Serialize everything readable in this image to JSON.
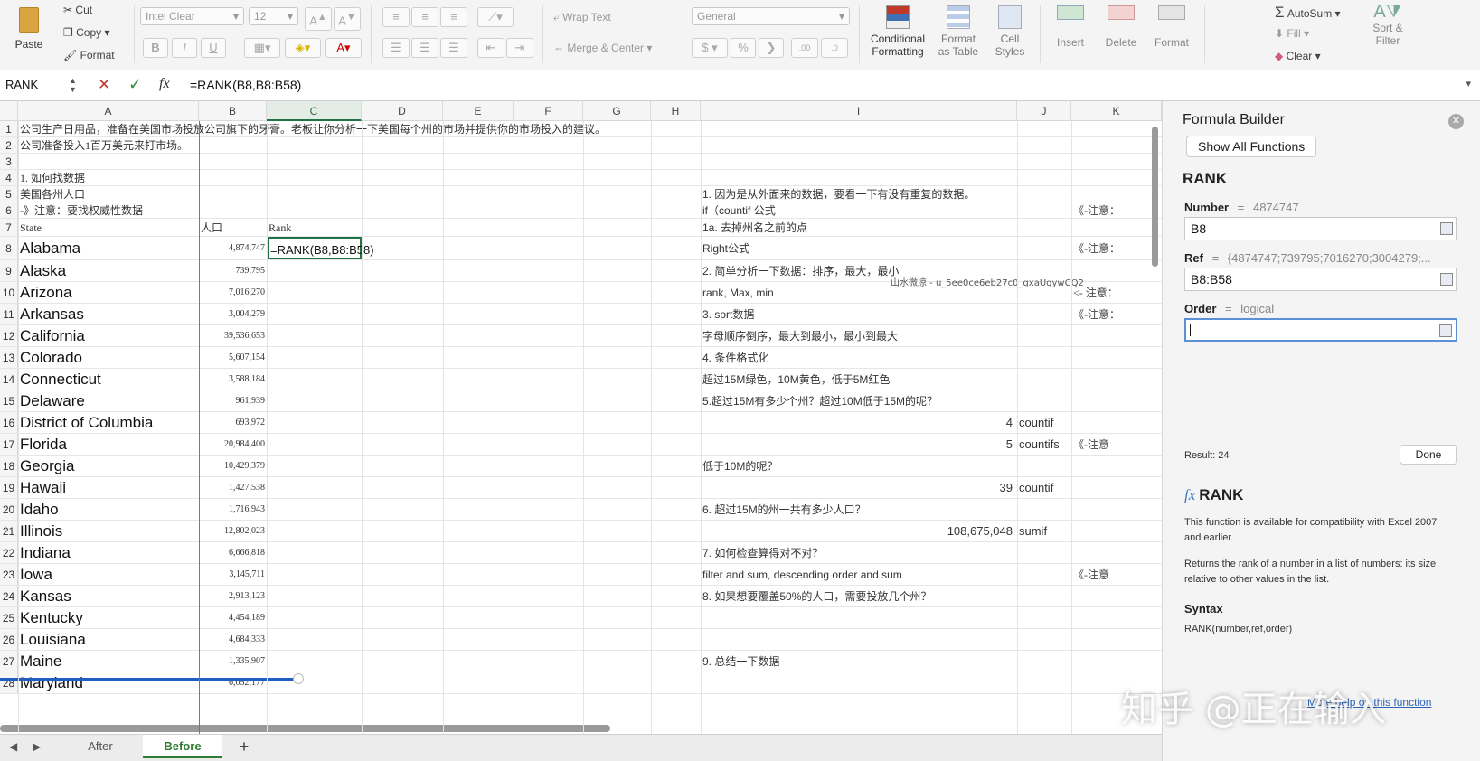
{
  "ribbon": {
    "paste": "Paste",
    "cut": "Cut",
    "copy": "Copy",
    "format_painter": "Format",
    "font_name": "Intel Clear",
    "font_size": "12",
    "bold": "B",
    "italic": "I",
    "underline": "U",
    "wrap_text": "Wrap Text",
    "merge_center": "Merge & Center",
    "number_format": "General",
    "conditional_formatting": [
      "Conditional",
      "Formatting"
    ],
    "format_as_table": [
      "Format",
      "as Table"
    ],
    "cell_styles": [
      "Cell",
      "Styles"
    ],
    "insert": "Insert",
    "delete": "Delete",
    "format": "Format",
    "autosum": "AutoSum",
    "fill": "Fill",
    "clear": "Clear",
    "sort_filter": [
      "Sort &",
      "Filter"
    ]
  },
  "formula_bar": {
    "name_box": "RANK",
    "cancel": "✕",
    "enter": "✓",
    "fx": "fx",
    "formula": "=RANK(B8,B8:B58)"
  },
  "columns": [
    "A",
    "B",
    "C",
    "D",
    "E",
    "F",
    "G",
    "H",
    "I",
    "J",
    "K"
  ],
  "rows": [
    {
      "n": "1",
      "a": "公司生产日用品，准备在美国市场投放公司旗下的牙膏。老板让你分析一下美国每个州的市场并提供你的市场投入的建议。"
    },
    {
      "n": "2",
      "a": "公司准备投入1百万美元来打市场。"
    },
    {
      "n": "3"
    },
    {
      "n": "4",
      "a": "1. 如何找数据"
    },
    {
      "n": "5",
      "a": "美国各州人口",
      "i": "1. 因为是从外面来的数据，要看一下有没有重复的数据。"
    },
    {
      "n": "6",
      "a": "-》注意：要找权威性数据",
      "i": "if（countif 公式",
      "k": "《-注意："
    },
    {
      "n": "7",
      "a": "State",
      "b": "人口",
      "c": "Rank",
      "i": "1a. 去掉州名之前的点"
    },
    {
      "n": "8",
      "a": "Alabama",
      "b": "4,874,747",
      "c": "=RANK(B8,B8:B58)",
      "i": "Right公式",
      "k": "《-注意："
    },
    {
      "n": "9",
      "a": "Alaska",
      "b": "739,795",
      "i": "2. 简单分析一下数据：排序，最大，最小"
    },
    {
      "n": "10",
      "a": "Arizona",
      "b": "7,016,270",
      "i": "rank,  Max,  min",
      "k": "<- 注意："
    },
    {
      "n": "11",
      "a": "Arkansas",
      "b": "3,004,279",
      "i": "3. sort数据",
      "k": "《-注意："
    },
    {
      "n": "12",
      "a": "California",
      "b": "39,536,653",
      "i": "字母顺序倒序，最大到最小，最小到最大"
    },
    {
      "n": "13",
      "a": "Colorado",
      "b": "5,607,154",
      "i": "4. 条件格式化"
    },
    {
      "n": "14",
      "a": "Connecticut",
      "b": "3,588,184",
      "i": "超过15M绿色，10M黄色，低于5M红色"
    },
    {
      "n": "15",
      "a": "Delaware",
      "b": "961,939",
      "i": "5.超过15M有多少个州？超过10M低于15M的呢？"
    },
    {
      "n": "16",
      "a": "District of Columbia",
      "b": "693,972",
      "iv": "4",
      "j": "countif"
    },
    {
      "n": "17",
      "a": "Florida",
      "b": "20,984,400",
      "iv": "5",
      "j": "countifs",
      "k": "《-注意"
    },
    {
      "n": "18",
      "a": "Georgia",
      "b": "10,429,379",
      "i": "低于10M的呢？"
    },
    {
      "n": "19",
      "a": "Hawaii",
      "b": "1,427,538",
      "iv": "39",
      "j": "countif"
    },
    {
      "n": "20",
      "a": "Idaho",
      "b": "1,716,943",
      "i": "6. 超过15M的州一共有多少人口？"
    },
    {
      "n": "21",
      "a": "Illinois",
      "b": "12,802,023",
      "iv": "108,675,048",
      "j": "sumif"
    },
    {
      "n": "22",
      "a": "Indiana",
      "b": "6,666,818",
      "i": "7. 如何检查算得对不对？"
    },
    {
      "n": "23",
      "a": "Iowa",
      "b": "3,145,711",
      "i": "filter and sum, descending order and sum",
      "k": "《-注意"
    },
    {
      "n": "24",
      "a": "Kansas",
      "b": "2,913,123",
      "i": "8. 如果想要覆盖50%的人口，需要投放几个州？"
    },
    {
      "n": "25",
      "a": "Kentucky",
      "b": "4,454,189"
    },
    {
      "n": "26",
      "a": "Louisiana",
      "b": "4,684,333"
    },
    {
      "n": "27",
      "a": "Maine",
      "b": "1,335,907",
      "i": "9. 总结一下数据"
    },
    {
      "n": "28",
      "a": "Maryland",
      "b": "6,052,177"
    }
  ],
  "overlay_text": "山水微凉 - u_5ee0ce6eb27c0_gxaUgywCQ2",
  "sheet_tabs": [
    "After",
    "Before"
  ],
  "add_sheet": "+",
  "panel": {
    "title": "Formula Builder",
    "show_all": "Show All Functions",
    "func": "RANK",
    "number_label": "Number",
    "number_hint": "4874747",
    "number_value": "B8",
    "ref_label": "Ref",
    "ref_hint": "{4874747;739795;7016270;3004279;...",
    "ref_value": "B8:B58",
    "order_label": "Order",
    "order_hint": "logical",
    "order_value": "",
    "eq": "=",
    "result": "Result: 24",
    "done": "Done",
    "help_fx": "fx",
    "help_title": "RANK",
    "help_p1": "This function is available for compatibility with Excel 2007 and earlier.",
    "help_p2": "Returns the rank of a number in a list of numbers: its size relative to other values in the list.",
    "syntax_label": "Syntax",
    "syntax": "RANK(number,ref,order)",
    "more_help": "More help on this function"
  },
  "watermark": "知乎 @正在输入"
}
